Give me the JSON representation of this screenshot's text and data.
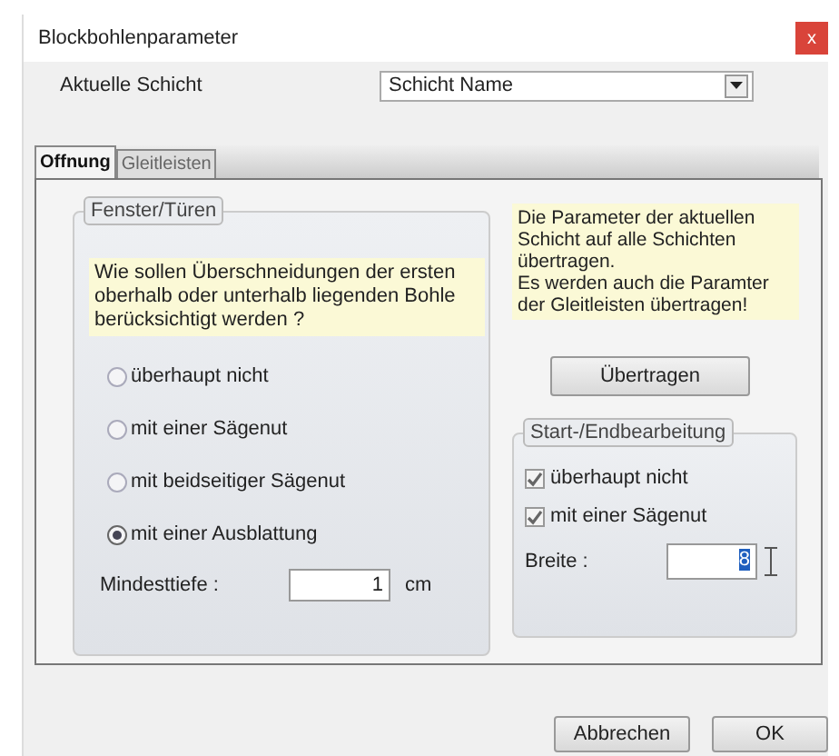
{
  "window": {
    "title": "Blockbohlenparameter",
    "close": "x"
  },
  "layer": {
    "label": "Aktuelle Schicht",
    "value": "Schicht Name"
  },
  "tabs": [
    {
      "label": "Offnung",
      "selected": true
    },
    {
      "label": "Gleitleisten",
      "selected": false
    }
  ],
  "openings": {
    "title": "Fenster/Türen",
    "note": "Wie sollen Überschneidungen der ersten oberhalb oder unterhalb liegenden Bohle berücksichtigt werden ?",
    "options": [
      {
        "label": "überhaupt nicht",
        "selected": false
      },
      {
        "label": "mit einer Sägenut",
        "selected": false
      },
      {
        "label": "mit beidseitiger Sägenut",
        "selected": false
      },
      {
        "label": "mit einer Ausblattung",
        "selected": true
      }
    ],
    "depth": {
      "label": "Mindesttiefe :",
      "value": "1",
      "unit": "cm"
    }
  },
  "transfer": {
    "note": "Die Parameter der aktuellen Schicht auf alle Schichten übertragen.\nEs werden auch die Paramter der Gleitleisten übertragen!",
    "button": "Übertragen"
  },
  "ends": {
    "title": "Start-/Endbearbeitung",
    "options": [
      {
        "label": "überhaupt nicht",
        "checked": true
      },
      {
        "label": "mit einer Sägenut",
        "checked": true
      }
    ],
    "width": {
      "label": "Breite :",
      "value": "8"
    }
  },
  "buttons": [
    "Abbrechen",
    "OK"
  ]
}
